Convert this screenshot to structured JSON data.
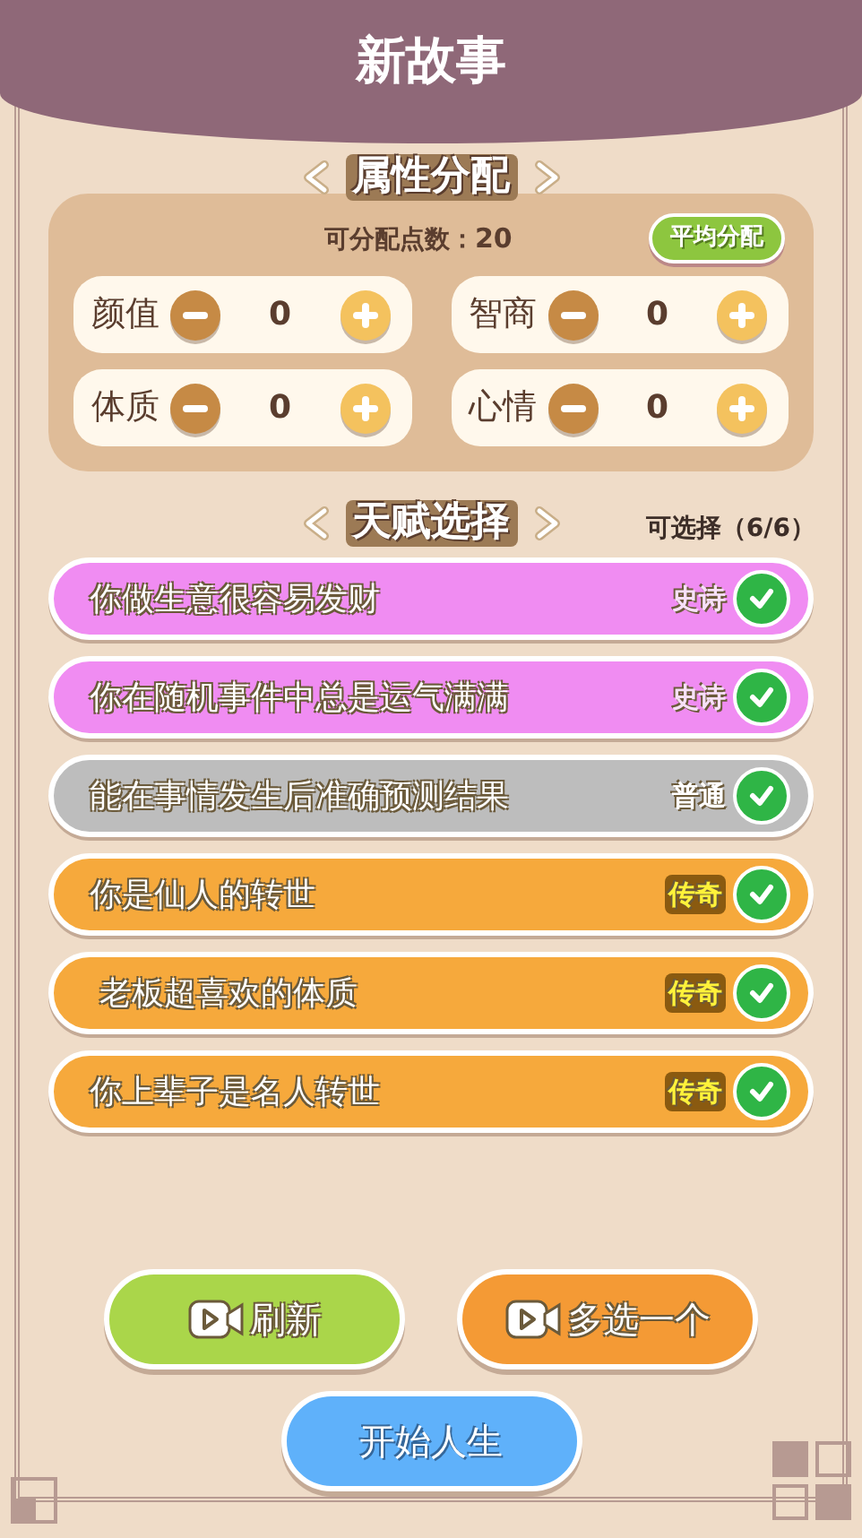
{
  "header": {
    "title": "新故事"
  },
  "attributes": {
    "title": "属性分配",
    "points_label": "可分配点数：",
    "points": "20",
    "even_button": "平均分配",
    "stats": [
      {
        "label": "颜值",
        "value": "0"
      },
      {
        "label": "智商",
        "value": "0"
      },
      {
        "label": "体质",
        "value": "0"
      },
      {
        "label": "心情",
        "value": "0"
      }
    ]
  },
  "talents": {
    "title": "天赋选择",
    "counter": "可选择（6/6）",
    "items": [
      {
        "text": "你做生意很容易发财",
        "rarity": "史诗",
        "kind": "epic",
        "checked": true
      },
      {
        "text": "你在随机事件中总是运气满满",
        "rarity": "史诗",
        "kind": "epic",
        "checked": true
      },
      {
        "text": "能在事情发生后准确预测结果",
        "rarity": "普通",
        "kind": "common",
        "checked": true
      },
      {
        "text": "你是仙人的转世",
        "rarity": "传奇",
        "kind": "legendary",
        "checked": true
      },
      {
        "text": " 老板超喜欢的体质",
        "rarity": "传奇",
        "kind": "legendary",
        "checked": true
      },
      {
        "text": "你上辈子是名人转世",
        "rarity": "传奇",
        "kind": "legendary",
        "checked": true
      }
    ]
  },
  "buttons": [
    {
      "label": "刷新",
      "kind": "refresh"
    },
    {
      "label": "多选一个",
      "kind": "extra"
    }
  ],
  "start_button": "开始人生"
}
